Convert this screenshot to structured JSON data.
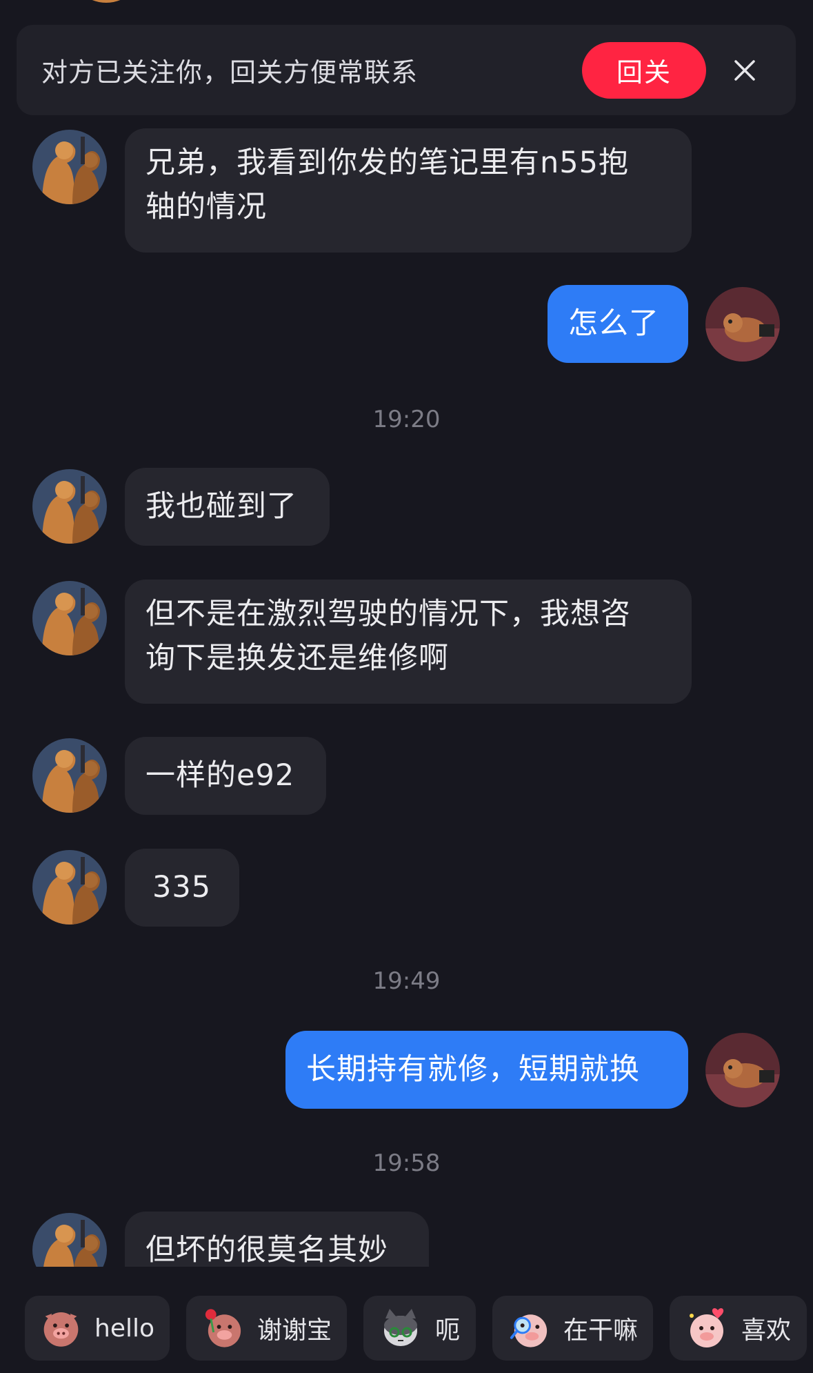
{
  "banner": {
    "text": "对方已关注你，回关方便常联系",
    "button_label": "回关",
    "close_icon": "close-icon",
    "button_color": "#ff2442"
  },
  "messages": [
    {
      "sender": "them",
      "text_line1": "兄弟，我看到你发的笔记里有n55抱",
      "text_line2": "轴的情况"
    },
    {
      "sender": "me",
      "text": "怎么了"
    },
    {
      "time": "19:20"
    },
    {
      "sender": "them",
      "text": "我也碰到了"
    },
    {
      "sender": "them",
      "text_line1": "但不是在激烈驾驶的情况下，我想咨",
      "text_line2": "询下是换发还是维修啊"
    },
    {
      "sender": "them",
      "text": "一样的e92"
    },
    {
      "sender": "them",
      "text": "335"
    },
    {
      "time": "19:49"
    },
    {
      "sender": "me",
      "text": "长期持有就修，短期就换"
    },
    {
      "time": "19:58"
    },
    {
      "sender": "them",
      "text": "但坏的很莫名其妙"
    }
  ],
  "quick_replies": [
    {
      "label": "hello",
      "icon": "pig-wave-icon"
    },
    {
      "label": "谢谢宝",
      "icon": "pig-rose-icon"
    },
    {
      "label": "呃",
      "icon": "cat-icon"
    },
    {
      "label": "在干嘛",
      "icon": "pig-magnifier-icon"
    },
    {
      "label": "喜欢",
      "icon": "pig-heart-icon"
    }
  ],
  "colors": {
    "background": "#17171f",
    "incoming_bubble": "#26262e",
    "outgoing_bubble": "#2e7cf6",
    "timestamp": "#7c7c86"
  }
}
